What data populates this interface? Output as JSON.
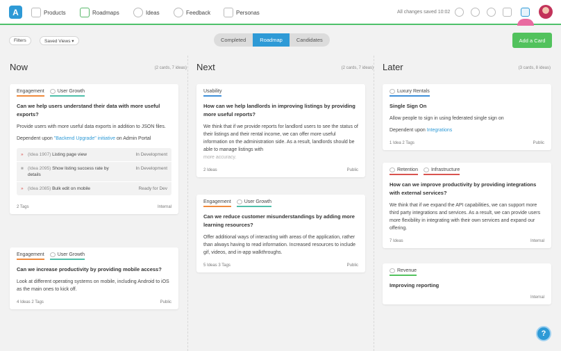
{
  "brand": {
    "color": "#2e9ad6",
    "green": "#52c25d",
    "logo_glyph": "A"
  },
  "nav": [
    {
      "label": "Products",
      "icon": "cube-icon"
    },
    {
      "label": "Roadmaps",
      "icon": "grid-icon"
    },
    {
      "label": "Ideas",
      "icon": "lightbulb-icon"
    },
    {
      "label": "Feedback",
      "icon": "chat-heart-icon"
    },
    {
      "label": "Personas",
      "icon": "person-icon"
    }
  ],
  "status": "All changes saved 10:02",
  "toolbar": {
    "filters": "Filters",
    "saved_views": "Saved Views ▾",
    "add_card": "Add a Card",
    "tabs": [
      "Completed",
      "Roadmap",
      "Candidates"
    ],
    "active_tab": "Roadmap"
  },
  "columns": [
    {
      "title": "Now",
      "meta": "(2 cards, 7 ideas)"
    },
    {
      "title": "Next",
      "meta": "(2 cards, 7 ideas)"
    },
    {
      "title": "Later",
      "meta": "(3 cards, 8 ideas)"
    }
  ],
  "tag_colors": {
    "Engagement": "#f08a3c",
    "User Growth": "#4fbfa9",
    "Usability": "#3e8fd8",
    "Luxury Rentals": "#3e8fd8",
    "Retention": "#d9534f",
    "Infrastructure": "#d9534f",
    "Revenue": "#52c25d"
  },
  "cards": {
    "now1": {
      "tags": [
        "Engagement",
        "User Growth"
      ],
      "title": "Can we help users understand their data with more useful exports?",
      "body": "Provide users with more useful data exports in addition to JSON files.",
      "dep_prefix": "Dependent upon ",
      "dep_link": "\"Backend Upgrade\" initiative",
      "dep_suffix": " on Admin Portal",
      "subs": [
        {
          "bullet": "»",
          "id": "(Idea 1907)",
          "text": "Listing page view",
          "status": "In Development"
        },
        {
          "bullet": "■",
          "id": "(Idea 2095)",
          "text": "Show listing success rate by details",
          "status": "In Development"
        },
        {
          "bullet": "»",
          "id": "(Idea 2085)",
          "text": "Bulk edit on mobile",
          "status": "Ready for Dev"
        }
      ],
      "left": "2 Tags",
      "right": "Internal"
    },
    "now2": {
      "tags": [
        "Engagement",
        "User Growth"
      ],
      "title": "Can we increase productivity by providing mobile access?",
      "body": "Look at different operating systems on mobile, including Android to iOS as the main ones to kick off.",
      "left": "4 Ideas  2 Tags",
      "right": "Public"
    },
    "next1": {
      "tags": [
        "Usability"
      ],
      "title": "How can we help landlords in improving listings by providing more useful reports?",
      "body": "We think that if we provide reports for landlord users to see the status of their listings and their rental income, we can offer more useful information on the administration side. As a result, landlords should be able to manage listings with",
      "faded": "more accuracy.",
      "left": "2 Ideas",
      "right": "Public"
    },
    "next2": {
      "tags": [
        "Engagement",
        "User Growth"
      ],
      "title": "Can we reduce customer misunderstandings by adding more learning resources?",
      "body": "Offer additional ways of interacting with areas of the application, rather than always having to read information. Increased resources to include gif, videos, and in-app walkthroughs.",
      "left": "5 Ideas  3 Tags",
      "right": "Public"
    },
    "later1": {
      "tags": [
        "Luxury Rentals"
      ],
      "title": "Single Sign On",
      "body": "Allow people to sign in using federated single sign on",
      "dep_prefix": "Dependent upon ",
      "dep_link": "Integrations",
      "left": "1 Idea  2 Tags",
      "right": "Public"
    },
    "later2": {
      "tags": [
        "Retention",
        "Infrastructure"
      ],
      "title": "How can we improve productivity by providing integrations with external services?",
      "body": "We think that if we expand the API capabilities, we can support more third party integrations and services. As a result, we can provide users more flexibility in integrating with their own services and expand our offering.",
      "left": "7 Ideas",
      "right": "Internal"
    },
    "later3": {
      "tags": [
        "Revenue"
      ],
      "title": "Improving reporting",
      "left": "",
      "right": "Internal"
    }
  },
  "help": "?"
}
